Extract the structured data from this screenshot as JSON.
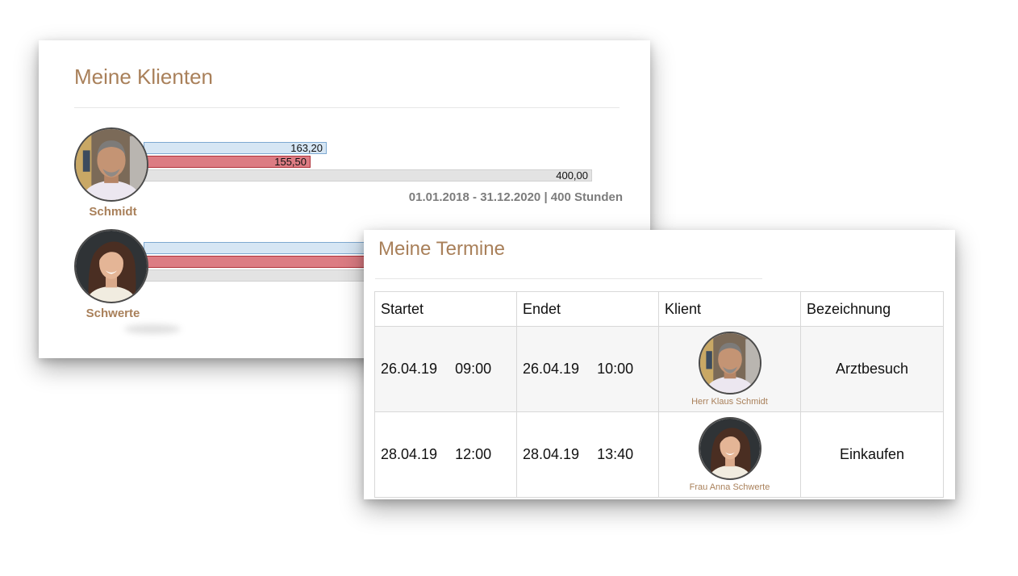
{
  "clients_panel": {
    "title": "Meine Klienten",
    "clients": [
      {
        "name": "Schmidt",
        "booked_hours": "163,20",
        "used_hours": "155,50",
        "total_hours": "400,00",
        "period_label": "01.01.2018 - 31.12.2020 | 400 Stunden",
        "avatar": "man-portrait-photo"
      },
      {
        "name": "Schwerte",
        "avatar": "woman-portrait-photo"
      }
    ]
  },
  "appointments_panel": {
    "title": "Meine Termine",
    "columns": [
      "Startet",
      "Endet",
      "Klient",
      "Bezeichnung"
    ],
    "rows": [
      {
        "start_date": "26.04.19",
        "start_time": "09:00",
        "end_date": "26.04.19",
        "end_time": "10:00",
        "client": "Herr Klaus Schmidt",
        "avatar": "man-portrait-photo",
        "description": "Arztbesuch"
      },
      {
        "start_date": "28.04.19",
        "start_time": "12:00",
        "end_date": "28.04.19",
        "end_time": "13:40",
        "client": "Frau Anna Schwerte",
        "avatar": "woman-portrait-photo",
        "description": "Einkaufen"
      }
    ]
  },
  "colors": {
    "title_accent": "#a9805a",
    "description_text": "#c5927a",
    "booked_bar": "#d6e6f4",
    "used_bar": "#dc7c83",
    "total_bar": "#e3e3e3"
  }
}
